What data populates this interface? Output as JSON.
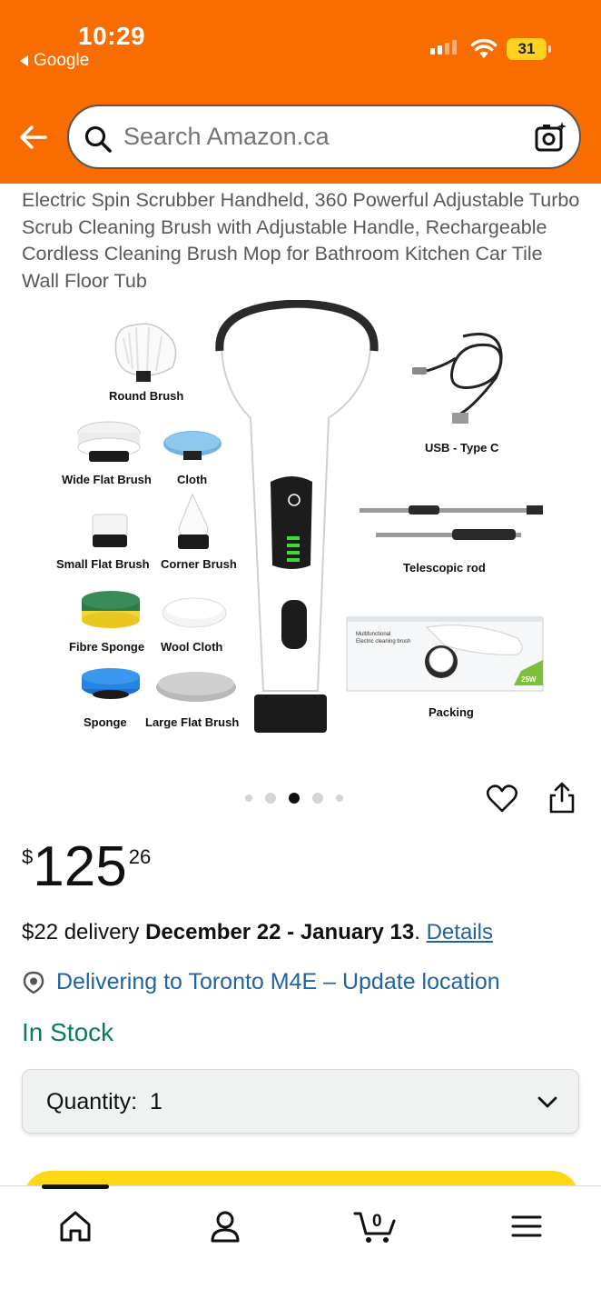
{
  "status_bar": {
    "time": "10:29",
    "back_app": "Google",
    "battery": "31"
  },
  "search": {
    "placeholder": "Search Amazon.ca"
  },
  "product": {
    "title": "Electric Spin Scrubber Handheld, 360 Powerful Adjustable Turbo Scrub Cleaning Brush with Adjustable Handle, Rechargeable Cordless Cleaning Brush Mop for Bathroom Kitchen Car Tile Wall Floor Tub",
    "image": {
      "accessory_labels": {
        "round_brush": "Round Brush",
        "wide_flat_brush": "Wide Flat Brush",
        "cloth": "Cloth",
        "small_flat_brush": "Small Flat Brush",
        "corner_brush": "Corner Brush",
        "fibre_sponge": "Fibre Sponge",
        "wool_cloth": "Wool Cloth",
        "sponge": "Sponge",
        "large_flat_brush": "Large Flat Brush",
        "usb": "USB - Type C",
        "telescopic_rod": "Telescopic rod",
        "packing": "Packing"
      },
      "box_text": [
        "Multifunctional",
        "Electric cleaning brush"
      ],
      "box_badge": "25W"
    },
    "carousel": {
      "count": 5,
      "active_index": 2
    }
  },
  "price": {
    "symbol": "$",
    "whole": "125",
    "fraction": "26"
  },
  "delivery": {
    "prefix": "$22 delivery ",
    "dates": "December 22 - January 13",
    "suffix": ". ",
    "details_link": "Details"
  },
  "location": {
    "text": "Delivering to Toronto M4E – Update location"
  },
  "stock": {
    "status": "In Stock"
  },
  "quantity": {
    "label": "Quantity:",
    "value": "1"
  },
  "cart": {
    "count": "0"
  },
  "colors": {
    "header": "#f86c00",
    "link": "#2162a1",
    "in_stock": "#067d62",
    "buy_button": "#ffd814"
  }
}
